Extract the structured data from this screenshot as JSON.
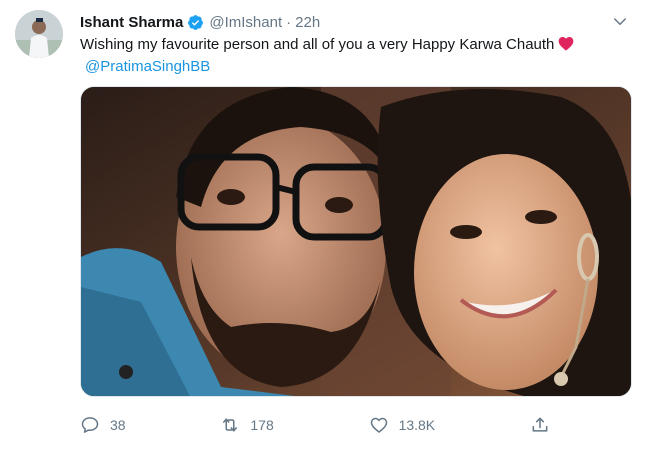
{
  "tweet": {
    "author_name": "Ishant Sharma",
    "handle": "@ImIshant",
    "separator": "·",
    "time": "22h",
    "text": "Wishing my favourite person and all of you a very Happy Karwa Chauth",
    "mention": "@PratimaSinghBB",
    "icons": {
      "verified": "verified-badge-icon",
      "more": "chevron-down-icon",
      "heart": "red-heart-emoji"
    },
    "colors": {
      "accent": "#1b95e0",
      "muted": "#657786",
      "heart": "#e0245e"
    }
  },
  "actions": {
    "reply_count": "38",
    "retweet_count": "178",
    "like_count": "13.8K"
  }
}
